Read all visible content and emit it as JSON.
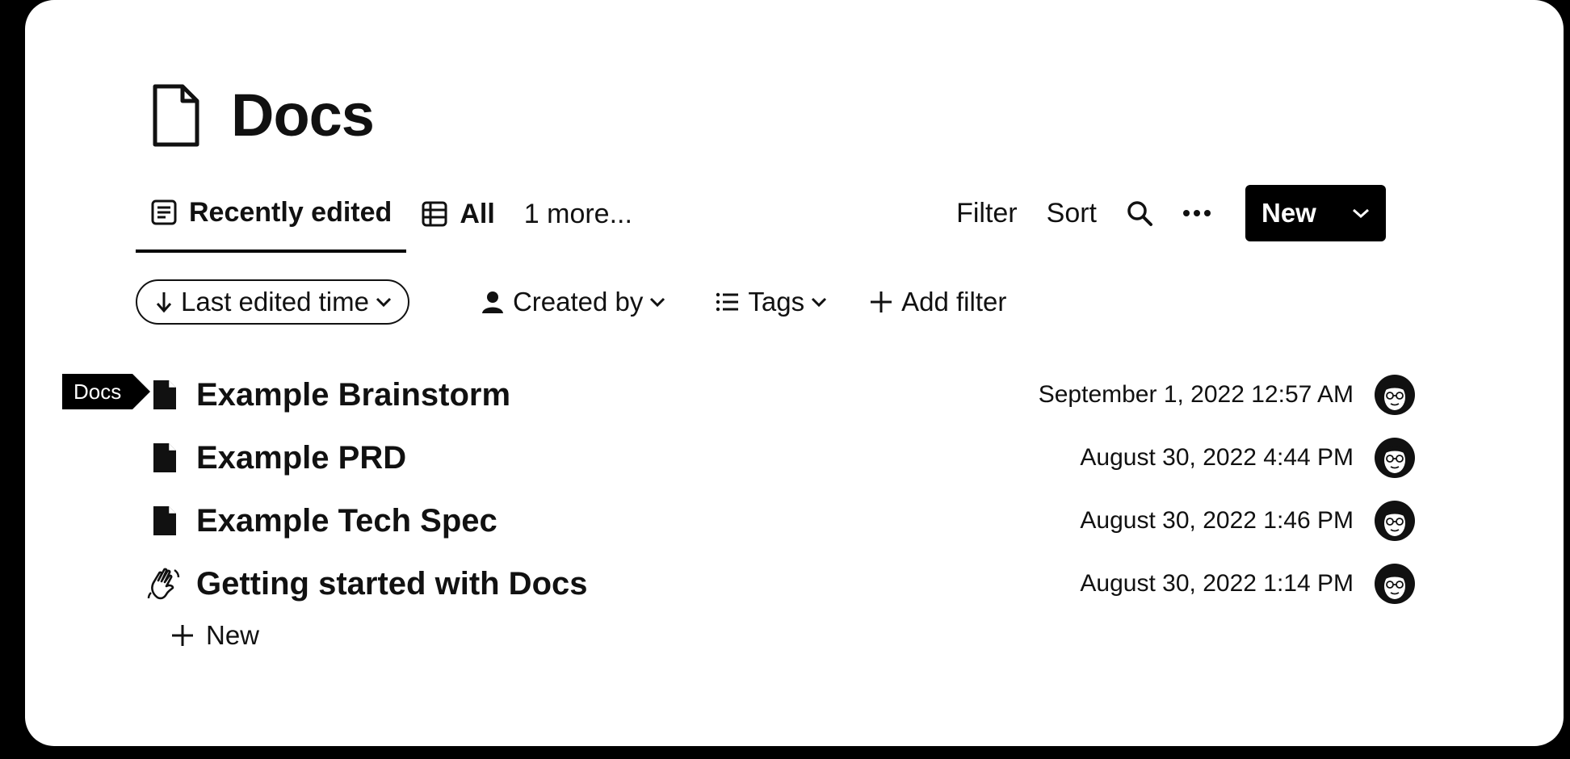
{
  "page": {
    "title": "Docs"
  },
  "tabs": [
    {
      "label": "Recently edited",
      "icon": "document-list-icon",
      "active": true
    },
    {
      "label": "All",
      "icon": "table-icon",
      "active": false
    },
    {
      "label": "1 more...",
      "icon": "",
      "active": false
    }
  ],
  "toolbar": {
    "filter_label": "Filter",
    "sort_label": "Sort",
    "search_icon": "search-icon",
    "more_icon": "more-options-icon",
    "new_label": "New"
  },
  "filters": {
    "sort_chip": "Last edited time",
    "created_by": "Created by",
    "tags": "Tags",
    "add_filter": "Add filter"
  },
  "side_tag": {
    "label": "Docs"
  },
  "rows": [
    {
      "title": "Example Brainstorm",
      "date": "September 1, 2022 12:57 AM",
      "icon": "document-icon"
    },
    {
      "title": "Example PRD",
      "date": "August 30, 2022 4:44 PM",
      "icon": "document-icon"
    },
    {
      "title": "Example Tech Spec",
      "date": "August 30, 2022 1:46 PM",
      "icon": "document-icon"
    },
    {
      "title": "Getting started with Docs",
      "date": "August 30, 2022 1:14 PM",
      "icon": "waving-hand-icon"
    }
  ],
  "new_row": {
    "label": "New"
  }
}
